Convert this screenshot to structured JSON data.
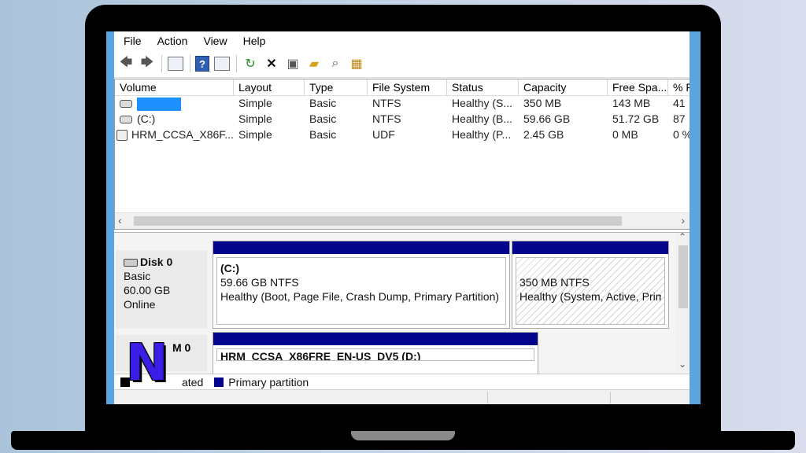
{
  "menu": [
    "File",
    "Action",
    "View",
    "Help"
  ],
  "toolbar": {
    "icons": [
      "back-arrow-icon",
      "forward-arrow-icon",
      "properties-icon",
      "help-icon",
      "console-icon",
      "refresh-icon",
      "delete-icon",
      "settings-icon",
      "open-folder-icon",
      "search-icon",
      "disk-icon"
    ],
    "help_glyph": "?",
    "delete_glyph": "✕",
    "refresh_glyph": "↻"
  },
  "volume_list": {
    "columns": [
      "Volume",
      "Layout",
      "Type",
      "File System",
      "Status",
      "Capacity",
      "Free Spa...",
      "% F"
    ],
    "rows": [
      {
        "volume": "",
        "layout": "Simple",
        "type": "Basic",
        "fs": "NTFS",
        "status": "Healthy (S...",
        "capacity": "350 MB",
        "free": "143 MB",
        "pct": "41"
      },
      {
        "volume": "(C:)",
        "layout": "Simple",
        "type": "Basic",
        "fs": "NTFS",
        "status": "Healthy (B...",
        "capacity": "59.66 GB",
        "free": "51.72 GB",
        "pct": "87"
      },
      {
        "volume": "HRM_CCSA_X86F...",
        "layout": "Simple",
        "type": "Basic",
        "fs": "UDF",
        "status": "Healthy (P...",
        "capacity": "2.45 GB",
        "free": "0 MB",
        "pct": "0 %"
      }
    ]
  },
  "disk0": {
    "name": "Disk 0",
    "type": "Basic",
    "size": "60.00 GB",
    "state": "Online",
    "partitions": [
      {
        "title": "(C:)",
        "size": "59.66 GB NTFS",
        "status": "Healthy (Boot, Page File, Crash Dump, Primary Partition)"
      },
      {
        "size": "350 MB NTFS",
        "status": "Healthy (System, Active, Prim"
      }
    ]
  },
  "cdrom": {
    "name_partial": "M 0",
    "volume": "HRM_CCSA_X86FRE_EN-US_DV5 (D:)"
  },
  "legend": {
    "item1_partial": "ated",
    "item2": "Primary partition"
  },
  "overlay_logo": "N",
  "colors": {
    "primary_partition": "#04048c",
    "screen_edge": "#5aa5e0",
    "redaction": "#1e90ff"
  }
}
